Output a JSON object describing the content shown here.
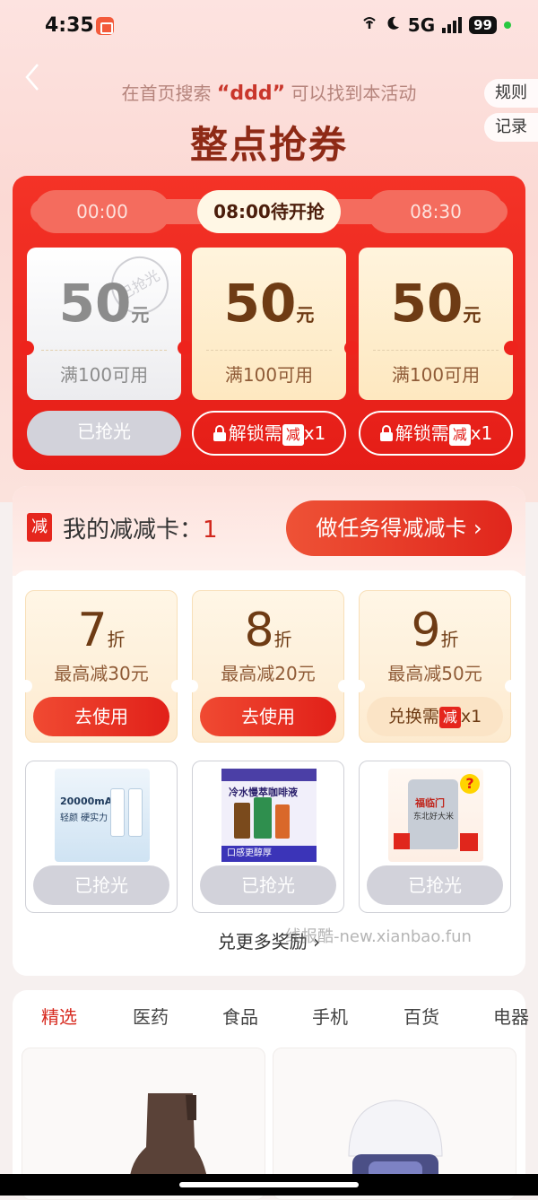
{
  "status_bar": {
    "time": "4:35",
    "network": "5G",
    "battery": "99"
  },
  "header": {
    "tip_prefix": "在首页搜索",
    "tip_keyword": "“ddd”",
    "tip_suffix": "可以找到本活动",
    "title": "整点抢券",
    "rules_label": "规则",
    "records_label": "记录"
  },
  "flash_coupons": {
    "slots": [
      {
        "label": "00:00"
      },
      {
        "label": "08:00待开抢"
      },
      {
        "label": "08:30"
      }
    ],
    "coupons": [
      {
        "amount": "50",
        "unit": "元",
        "condition": "满100可用",
        "stamp": "已抢光",
        "button": "已抢光",
        "state": "sold_out"
      },
      {
        "amount": "50",
        "unit": "元",
        "condition": "满100可用",
        "button_text": "解锁需",
        "tag": "减",
        "count": "x1",
        "state": "locked"
      },
      {
        "amount": "50",
        "unit": "元",
        "condition": "满100可用",
        "button_text": "解锁需",
        "tag": "减",
        "count": "x1",
        "state": "locked"
      }
    ],
    "colors": {
      "panel": "#e51d17",
      "gold": "#fee8c0"
    }
  },
  "reduce_card": {
    "icon_text": "减",
    "label": "我的减减卡：",
    "count": "1",
    "task_button": "做任务得减减卡 ›",
    "discounts": [
      {
        "value": "7",
        "unit": "折",
        "desc": "最高减30元",
        "button": "去使用"
      },
      {
        "value": "8",
        "unit": "折",
        "desc": "最高减20元",
        "button": "去使用"
      },
      {
        "value": "9",
        "unit": "折",
        "desc": "最高减50元",
        "button_text": "兑换需",
        "tag": "减",
        "count": "x1"
      }
    ],
    "products": [
      {
        "image": "power-bank-image",
        "img_text": "20000mAh",
        "img_sub": "轻颜 硬实力",
        "button": "已抢光"
      },
      {
        "image": "coffee-liquid-image",
        "img_text": "冷水慢萃咖啡液",
        "img_sub": "口感更醇厚",
        "button": "已抢光"
      },
      {
        "image": "rice-bag-image",
        "img_text": "福临门",
        "img_sub": "东北好大米",
        "button": "已抢光"
      }
    ],
    "more_label": "兑更多奖励"
  },
  "watermark": "线报酷-new.xianbao.fun",
  "categories": {
    "tabs": [
      "精选",
      "医药",
      "食品",
      "手机",
      "百货",
      "电器"
    ],
    "active_index": 0
  }
}
